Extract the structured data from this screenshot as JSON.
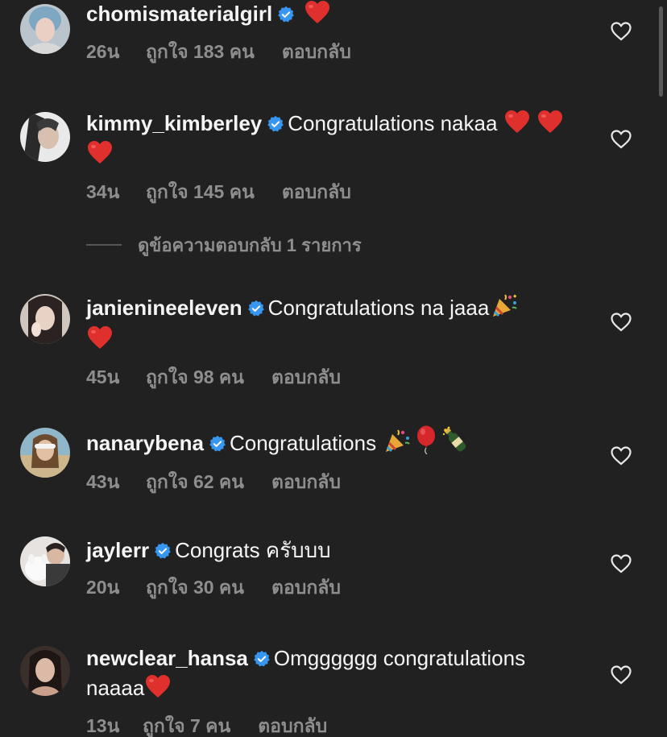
{
  "colors": {
    "background": "#212121",
    "text": "#f5f5f5",
    "muted": "#8e8e8e",
    "verified": "#3797f0",
    "heart": "#e0302e"
  },
  "view_replies": {
    "label": "ดูข้อความตอบกลับ 1 รายการ"
  },
  "comments": [
    {
      "username": "chomismaterialgirl",
      "verified": true,
      "text": "",
      "emoji": [
        "heart"
      ],
      "time": "26น",
      "likes": "ถูกใจ 183 คน",
      "reply": "ตอบกลับ",
      "avatar_icon": "avatar-photo"
    },
    {
      "username": "kimmy_kimberley",
      "verified": true,
      "text": "Congratulations nakaa",
      "emoji": [
        "heart",
        "heart",
        "heart"
      ],
      "time": "34น",
      "likes": "ถูกใจ 145 คน",
      "reply": "ตอบกลับ",
      "avatar_icon": "avatar-photo"
    },
    {
      "username": "janienineeleven",
      "verified": true,
      "text": "Congratulations na jaaa",
      "emoji": [
        "party-popper",
        "heart"
      ],
      "time": "45น",
      "likes": "ถูกใจ 98 คน",
      "reply": "ตอบกลับ",
      "avatar_icon": "avatar-photo"
    },
    {
      "username": "nanarybena",
      "verified": true,
      "text": "Congratulations",
      "emoji": [
        "party-popper",
        "balloon",
        "champagne"
      ],
      "time": "43น",
      "likes": "ถูกใจ 62 คน",
      "reply": "ตอบกลับ",
      "avatar_icon": "avatar-photo"
    },
    {
      "username": "jaylerr",
      "verified": true,
      "text": "Congrats ครับบบ",
      "emoji": [],
      "time": "20น",
      "likes": "ถูกใจ 30 คน",
      "reply": "ตอบกลับ",
      "avatar_icon": "avatar-photo"
    },
    {
      "username": "newclear_hansa",
      "verified": true,
      "text": "Omgggggg congratulations naaaa",
      "emoji": [
        "heart"
      ],
      "time": "13น",
      "likes": "ถูกใจ 7 คน",
      "reply": "ตอบกลับ",
      "avatar_icon": "avatar-photo"
    }
  ]
}
